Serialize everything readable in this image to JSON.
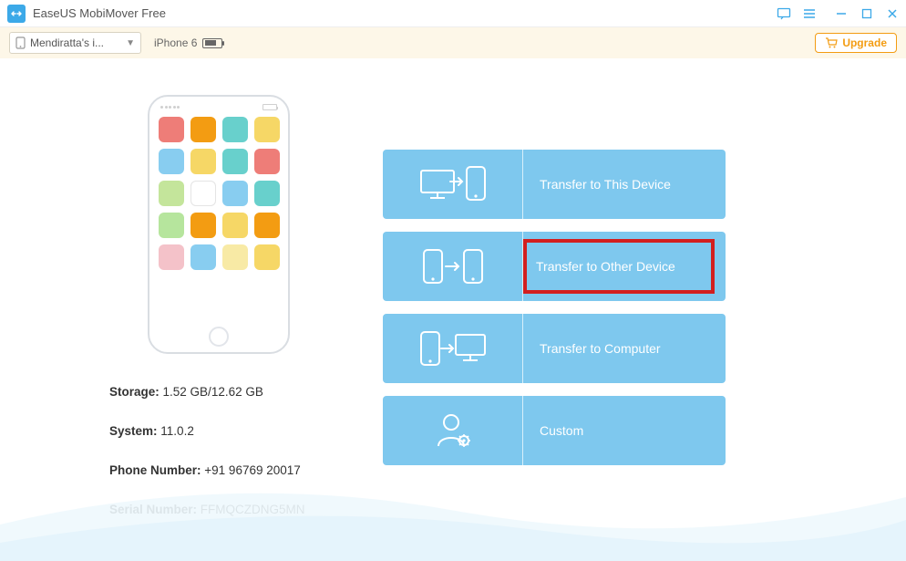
{
  "titlebar": {
    "app_name": "EaseUS MobiMover Free"
  },
  "devicebar": {
    "dropdown_label": "Mendiratta's i...",
    "device_model": "iPhone 6",
    "upgrade_label": "Upgrade"
  },
  "phone": {
    "app_colors": [
      "#ee7d78",
      "#f39c12",
      "#68d0cc",
      "#f6d766",
      "#88cdf0",
      "#f6d766",
      "#68d0cc",
      "#ee7d78",
      "#c4e59b",
      "#ffffff",
      "#88cdf0",
      "#68d0cc",
      "#b6e59d",
      "#f39c12",
      "#f6d766",
      "#f39c12",
      "#f4c2c9",
      "#88cdf0",
      "#f8eaa5",
      "#f6d766"
    ]
  },
  "info": {
    "storage_label": "Storage:",
    "storage_value": "1.52 GB/12.62 GB",
    "system_label": "System:",
    "system_value": "11.0.2",
    "phone_label": "Phone Number:",
    "phone_value": "+91 96769 20017",
    "serial_label": "Serial Number:",
    "serial_value": "FFMQCZDNG5MN"
  },
  "options": {
    "to_this": "Transfer to This Device",
    "to_other": "Transfer to Other Device",
    "to_computer": "Transfer to Computer",
    "custom": "Custom"
  }
}
